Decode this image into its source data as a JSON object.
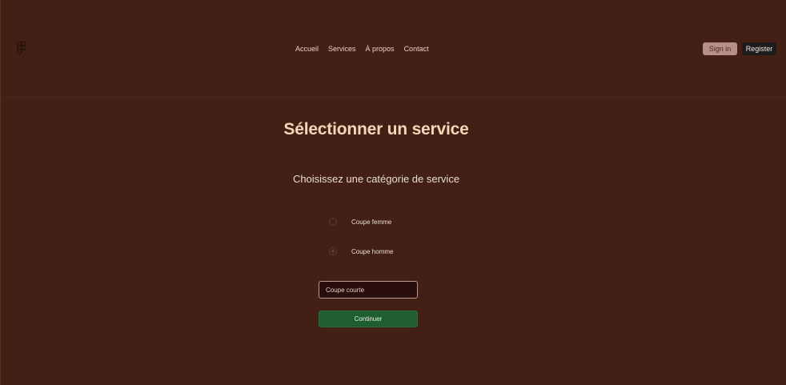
{
  "header": {
    "logo_icon": "figma-logo-icon",
    "nav": [
      {
        "label": "Accueil"
      },
      {
        "label": "Services"
      },
      {
        "label": "À propos"
      },
      {
        "label": "Contact"
      }
    ],
    "signin_label": "Sign in",
    "register_label": "Register"
  },
  "main": {
    "title": "Sélectionner un service",
    "subtitle": "Choisissez une catégorie de service",
    "options": [
      {
        "label": "Coupe femme",
        "checked": false
      },
      {
        "label": "Coupe homme",
        "checked": true
      }
    ],
    "input_value": "Coupe courte",
    "continue_label": "Continuer"
  },
  "colors": {
    "background": "#432015",
    "title": "#f4d6b9",
    "signin_bg": "#b98f8b",
    "register_bg": "#1c1c1c",
    "continue_bg": "#1f5e2e",
    "input_bg": "#2a0e0b"
  }
}
